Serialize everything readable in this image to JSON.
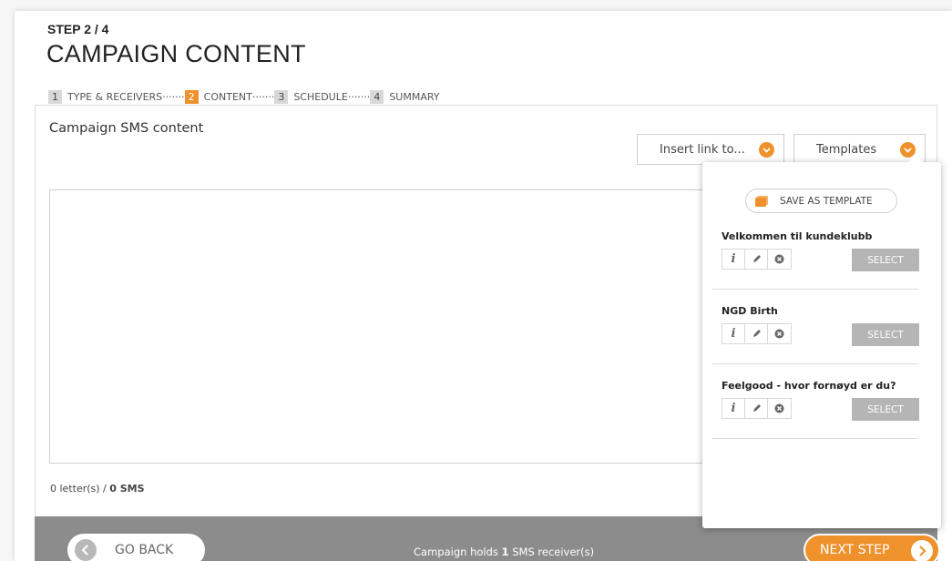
{
  "header": {
    "step_label": "STEP 2 / 4",
    "title": "CAMPAIGN CONTENT"
  },
  "stepper": [
    {
      "num": "1",
      "label": "TYPE & RECEIVERS",
      "active": false
    },
    {
      "num": "2",
      "label": "CONTENT",
      "active": true
    },
    {
      "num": "3",
      "label": "SCHEDULE",
      "active": false
    },
    {
      "num": "4",
      "label": "SUMMARY",
      "active": false
    }
  ],
  "stepper_separator": "·······",
  "panel": {
    "title": "Campaign SMS content",
    "insert_link_label": "Insert link to...",
    "templates_label": "Templates",
    "textarea_value": "",
    "counter_letters": "0 letter(s) / ",
    "counter_sms": "0 SMS"
  },
  "templates_menu": {
    "save_label": "SAVE AS TEMPLATE",
    "items": [
      {
        "name": "Velkommen til kundeklubb",
        "select_label": "SELECT"
      },
      {
        "name": "NGD Birth",
        "select_label": "SELECT"
      },
      {
        "name": "Feelgood - hvor fornøyd er du?",
        "select_label": "SELECT"
      }
    ],
    "info_glyph": "i"
  },
  "footer": {
    "back_label": "GO BACK",
    "info_prefix": "Campaign holds ",
    "info_count": "1",
    "info_suffix": " SMS receiver(s)",
    "next_label": "NEXT STEP"
  },
  "colors": {
    "accent": "#f0922c",
    "footer_bg": "#8c8c8c",
    "select_bg": "#b5b5b5"
  },
  "icons": {
    "chevron": "chevron-down-icon",
    "back": "arrow-left-icon",
    "next": "arrow-right-icon",
    "info": "info-icon",
    "edit": "pencil-icon",
    "delete": "close-circle-icon",
    "save": "copy-icon"
  }
}
